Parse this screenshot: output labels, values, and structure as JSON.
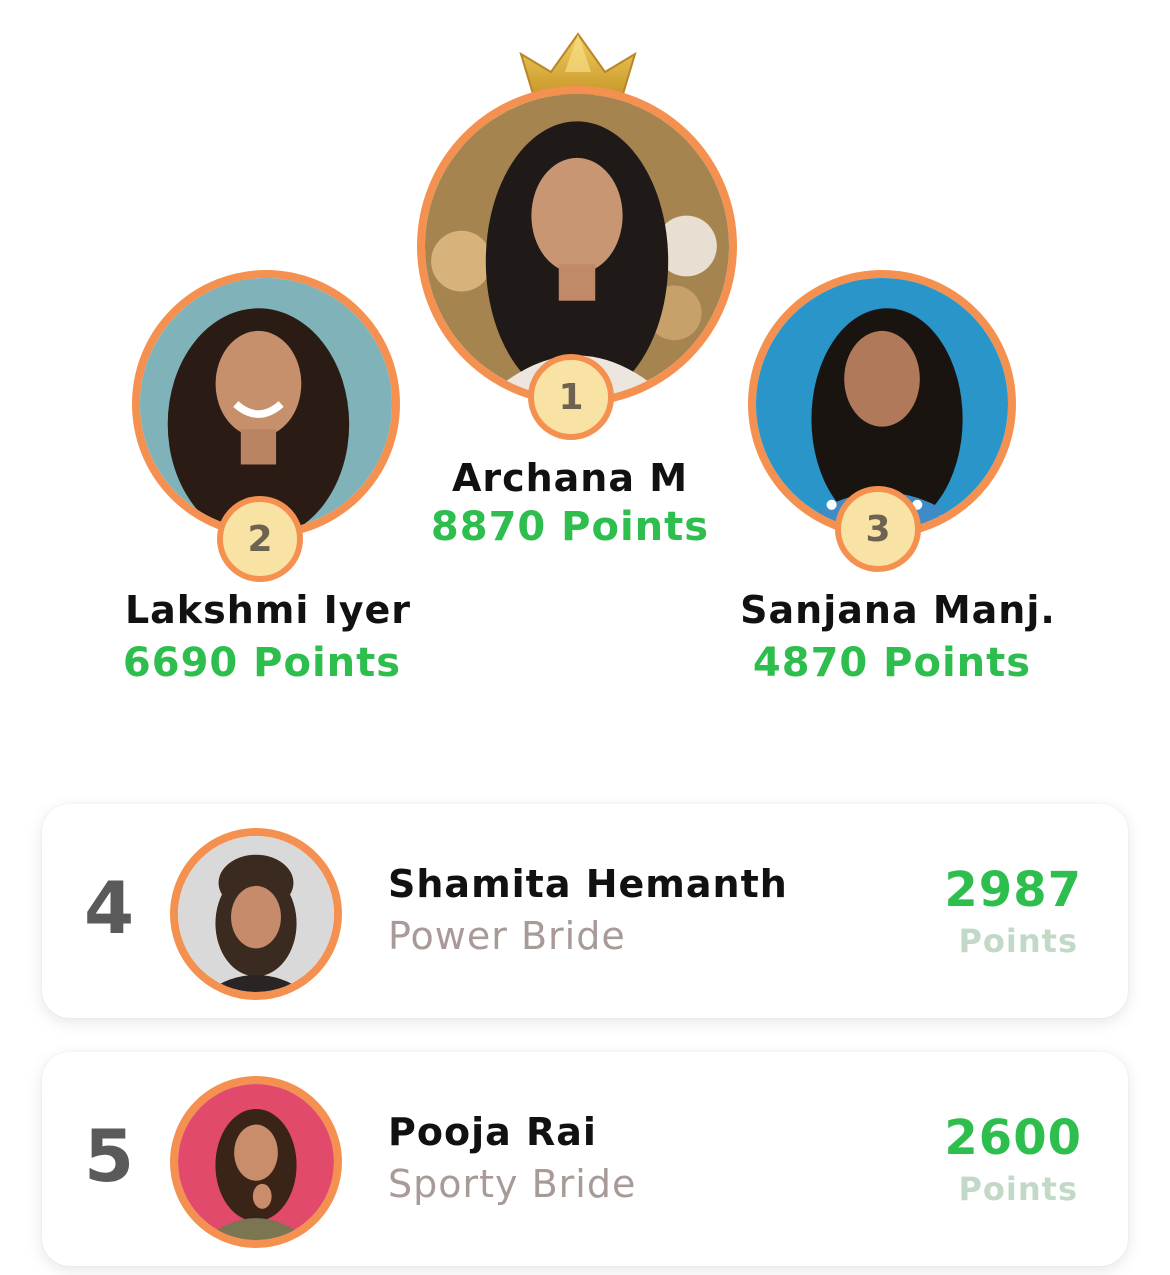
{
  "podium": [
    {
      "rank": "1",
      "name": "Archana M",
      "points": "8870 Points",
      "crown_icon": "crown-icon"
    },
    {
      "rank": "2",
      "name": "Lakshmi Iyer",
      "points": "6690 Points"
    },
    {
      "rank": "3",
      "name": "Sanjana Manj.",
      "points": "4870 Points"
    }
  ],
  "list": [
    {
      "rank": "4",
      "name": "Shamita Hemanth",
      "title": "Power Bride",
      "points": "2987",
      "points_label": "Points"
    },
    {
      "rank": "5",
      "name": "Pooja Rai",
      "title": "Sporty Bride",
      "points": "2600",
      "points_label": "Points"
    }
  ],
  "colors": {
    "accent_ring": "#f59150",
    "badge_fill": "#f8e3a4",
    "points_green": "#2dbe4e",
    "muted_points": "#c3d9c8",
    "subtitle_gray": "#a89a96"
  }
}
